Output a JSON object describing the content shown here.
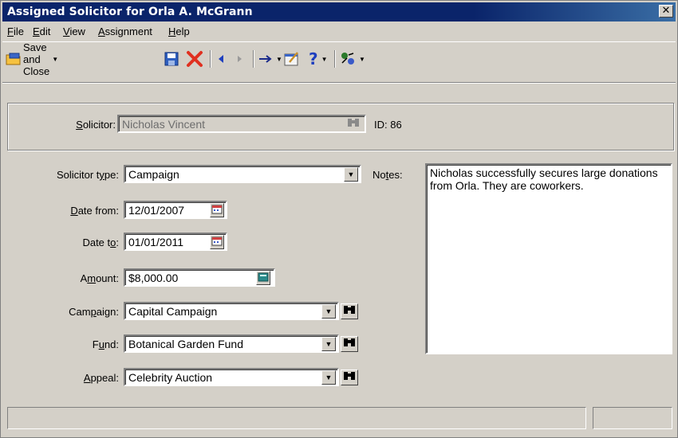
{
  "window": {
    "title": "Assigned Solicitor for Orla A. McGrann",
    "close_glyph": "✕"
  },
  "menu": {
    "file": "File",
    "edit": "Edit",
    "view": "View",
    "assignment": "Assignment",
    "help": "Help"
  },
  "toolbar": {
    "save_and_close": "Save and Close",
    "icons": [
      "save-and-close-icon",
      "save-icon",
      "delete-icon",
      "previous-record-icon",
      "next-record-icon",
      "go-to-icon",
      "properties-icon",
      "help-icon",
      "tools-icon"
    ]
  },
  "solicitor": {
    "label": "Solicitor:",
    "value": "Nicholas Vincent",
    "id_text": "ID: 86"
  },
  "form": {
    "solicitor_type_label": "Solicitor type:",
    "solicitor_type_value": "Campaign",
    "date_from_label": "Date from:",
    "date_from_value": "12/01/2007",
    "date_to_label": "Date to:",
    "date_to_value": "01/01/2011",
    "amount_label": "Amount:",
    "amount_value": "$8,000.00",
    "campaign_label": "Campaign:",
    "campaign_value": "Capital Campaign",
    "fund_label": "Fund:",
    "fund_value": "Botanical Garden Fund",
    "appeal_label": "Appeal:",
    "appeal_value": "Celebrity Auction",
    "notes_label": "Notes:",
    "notes_value": "Nicholas successfully secures large donations from Orla. They are coworkers."
  },
  "colors": {
    "titlebar": "#0a246a",
    "face": "#d4d0c8",
    "delete_red": "#e03020",
    "nav_blue": "#1f3fbf"
  }
}
